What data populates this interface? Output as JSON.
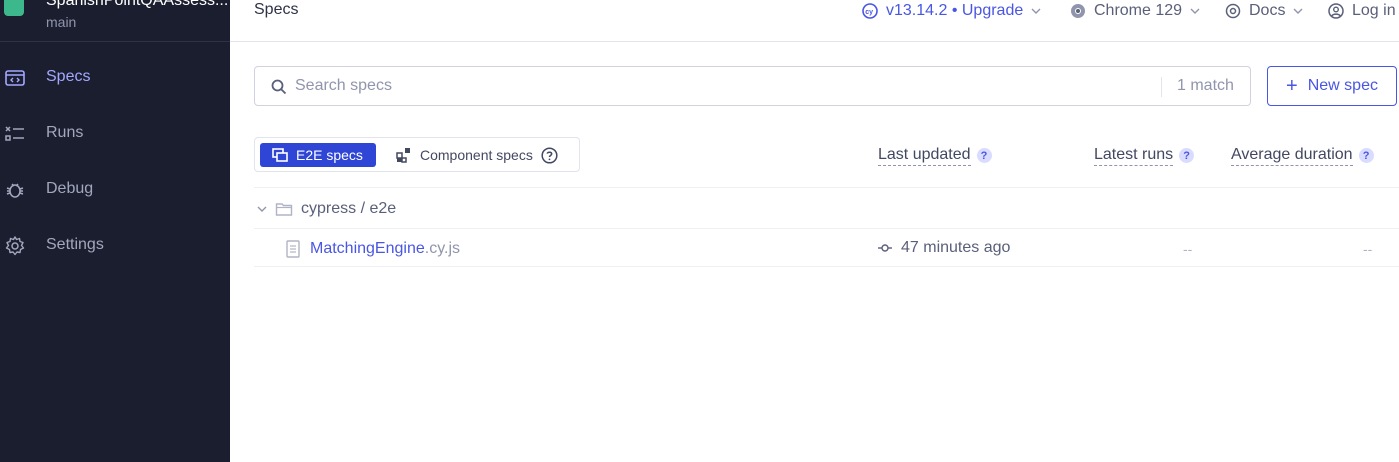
{
  "project": {
    "name": "SpanishPointQAAssess...",
    "branch": "main"
  },
  "sidebar": {
    "items": [
      {
        "label": "Specs",
        "icon": "specs-icon",
        "active": true
      },
      {
        "label": "Runs",
        "icon": "runs-icon",
        "active": false
      },
      {
        "label": "Debug",
        "icon": "debug-icon",
        "active": false
      },
      {
        "label": "Settings",
        "icon": "settings-icon",
        "active": false
      }
    ]
  },
  "header": {
    "title": "Specs",
    "version": "v13.14.2 • Upgrade",
    "browser": "Chrome 129",
    "docs": "Docs",
    "login": "Log in"
  },
  "search": {
    "placeholder": "Search specs",
    "value": "",
    "match_count": "1 match"
  },
  "new_spec_label": "New spec",
  "tabs": {
    "e2e": "E2E specs",
    "component": "Component specs"
  },
  "columns": {
    "last_updated": "Last updated",
    "latest_runs": "Latest runs",
    "average_duration": "Average duration",
    "help": "?"
  },
  "folder": "cypress / e2e",
  "spec": {
    "name": "MatchingEngine",
    "ext": ".cy.js",
    "last_updated": "47 minutes ago",
    "latest_runs": "--",
    "average_duration": "--"
  },
  "colors": {
    "sidebar_bg": "#1b1e2e",
    "accent": "#4956e3",
    "active_tab": "#2e45d6",
    "project_logo": "#3db78c"
  }
}
